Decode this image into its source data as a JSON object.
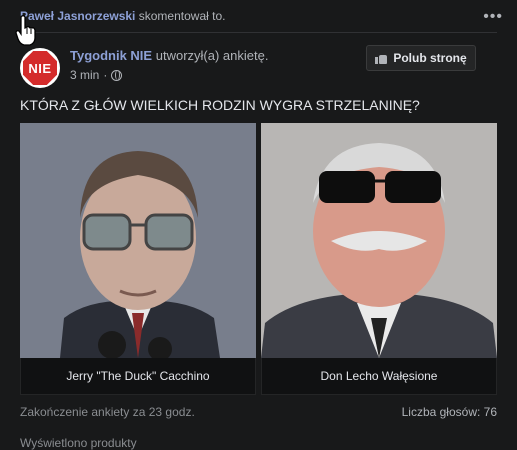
{
  "activity": {
    "user": "Paweł Jasnorzewski",
    "action": "skomentował to."
  },
  "post": {
    "page_name": "Tygodnik NIE",
    "action": "utworzył(a) ankietę.",
    "time": "3 min",
    "dot": "·",
    "avatar_text": "NIE",
    "like_page_label": "Polub stronę",
    "question": "KTÓRA Z GŁÓW WIELKICH RODZIN WYGRA STRZELANINĘ?"
  },
  "poll": {
    "options": [
      {
        "label": "Jerry \"The Duck\" Cacchino"
      },
      {
        "label": "Don Lecho Wałęsione"
      }
    ],
    "ends_text": "Zakończenie ankiety za 23 godz.",
    "votes_text": "Liczba głosów: 76"
  },
  "partial_text": "Wyświetlono produkty",
  "icons": {
    "more": "more-options-icon",
    "globe": "globe-icon",
    "like": "thumbs-up-icon",
    "cursor": "hand-cursor-icon"
  }
}
